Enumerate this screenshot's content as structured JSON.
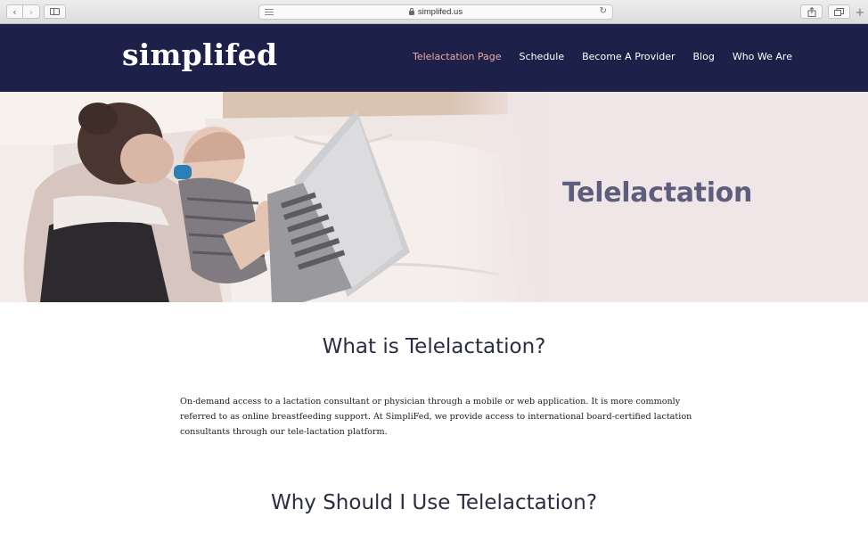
{
  "browser": {
    "url": "simplifed.us",
    "back_icon": "chevron-left-icon",
    "forward_icon": "chevron-right-icon",
    "sidebar_icon": "sidebar-icon",
    "reader_icon": "reader-icon",
    "lock_icon": "lock-icon",
    "reload_icon": "reload-icon",
    "share_icon": "share-icon",
    "tabs_icon": "tabs-icon",
    "new_tab_icon": "plus-icon"
  },
  "site": {
    "logo": "simplifed",
    "nav": [
      {
        "label": "Telelactation Page",
        "active": true
      },
      {
        "label": "Schedule",
        "active": false
      },
      {
        "label": "Become A Provider",
        "active": false
      },
      {
        "label": "Blog",
        "active": false
      },
      {
        "label": "Who We Are",
        "active": false
      }
    ],
    "colors": {
      "header_bg": "#1d2049",
      "nav_active": "#f2a9a0",
      "hero_bg": "#f1e6e7",
      "hero_title": "#5d5e7c"
    }
  },
  "hero": {
    "title": "Telelactation",
    "image_description": "mother-holding-baby-with-laptop"
  },
  "content": {
    "section1_title": "What is Telelactation?",
    "section1_body": "On-demand access to a lactation consultant or physician through a mobile or web application. It is more commonly referred to as online breastfeeding support. At SimpliFed, we provide access to international board-certified lactation consultants through our tele-lactation platform.",
    "section2_title": "Why Should I Use Telelactation?"
  }
}
